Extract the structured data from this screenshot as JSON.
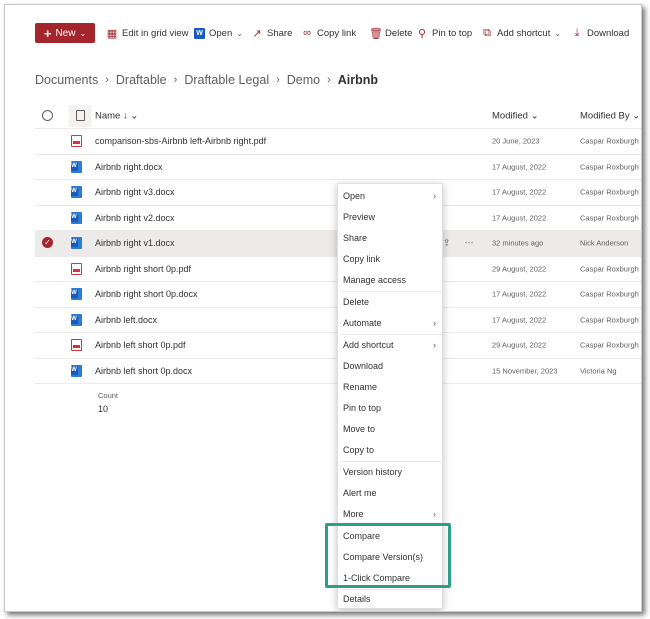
{
  "toolbar": {
    "new_label": "New",
    "items": [
      {
        "label": "Edit in grid view",
        "icon": "grid-icon"
      },
      {
        "label": "Open",
        "icon": "word-icon"
      },
      {
        "label": "Share",
        "icon": "share-icon"
      },
      {
        "label": "Copy link",
        "icon": "link-icon"
      },
      {
        "label": "Delete",
        "icon": "trash-icon"
      },
      {
        "label": "Pin to top",
        "icon": "pin-icon"
      },
      {
        "label": "Add shortcut",
        "icon": "shortcut-icon"
      },
      {
        "label": "Download",
        "icon": "download-icon"
      }
    ]
  },
  "breadcrumb": [
    "Documents",
    "Draftable",
    "Draftable Legal",
    "Demo",
    "Airbnb"
  ],
  "list": {
    "headers": {
      "name": "Name",
      "modified": "Modified",
      "modified_by": "Modified By"
    },
    "rows": [
      {
        "name": "comparison-sbs-Airbnb left-Airbnb right.pdf",
        "type": "pdf",
        "modified": "20 June, 2023",
        "by": "Caspar Roxburgh"
      },
      {
        "name": "Airbnb right.docx",
        "type": "word",
        "modified": "17 August, 2022",
        "by": "Caspar Roxburgh"
      },
      {
        "name": "Airbnb right v3.docx",
        "type": "word",
        "modified": "17 August, 2022",
        "by": "Caspar Roxburgh"
      },
      {
        "name": "Airbnb right v2.docx",
        "type": "word",
        "modified": "17 August, 2022",
        "by": "Caspar Roxburgh"
      },
      {
        "name": "Airbnb right v1.docx",
        "type": "word",
        "modified": "32 minutes ago",
        "by": "Nick Anderson",
        "selected": true
      },
      {
        "name": "Airbnb right short 0p.pdf",
        "type": "pdf",
        "modified": "29 August, 2022",
        "by": "Caspar Roxburgh"
      },
      {
        "name": "Airbnb right short 0p.docx",
        "type": "word",
        "modified": "17 August, 2022",
        "by": "Caspar Roxburgh"
      },
      {
        "name": "Airbnb left.docx",
        "type": "word",
        "modified": "17 August, 2022",
        "by": "Caspar Roxburgh"
      },
      {
        "name": "Airbnb left short 0p.pdf",
        "type": "pdf",
        "modified": "29 August, 2022",
        "by": "Caspar Roxburgh"
      },
      {
        "name": "Airbnb left short 0p.docx",
        "type": "word",
        "modified": "15 November, 2023",
        "by": "Victoria Ng"
      }
    ],
    "count_label": "Count",
    "count_value": "10"
  },
  "context_menu": {
    "items": [
      {
        "label": "Open",
        "submenu": true
      },
      {
        "label": "Preview"
      },
      {
        "label": "Share"
      },
      {
        "label": "Copy link"
      },
      {
        "label": "Manage access"
      },
      {
        "label": "Delete"
      },
      {
        "label": "Automate",
        "submenu": true
      },
      {
        "label": "Add shortcut",
        "submenu": true
      },
      {
        "label": "Download"
      },
      {
        "label": "Rename"
      },
      {
        "label": "Pin to top"
      },
      {
        "label": "Move to"
      },
      {
        "label": "Copy to"
      },
      {
        "label": "Version history"
      },
      {
        "label": "Alert me"
      },
      {
        "label": "More",
        "submenu": true
      },
      {
        "label": "Compare"
      },
      {
        "label": "Compare Version(s)"
      },
      {
        "label": "1-Click Compare"
      },
      {
        "label": "Details"
      }
    ]
  },
  "colors": {
    "accent": "#a4262c",
    "highlight": "#2e9e86",
    "word": "#185abd"
  }
}
